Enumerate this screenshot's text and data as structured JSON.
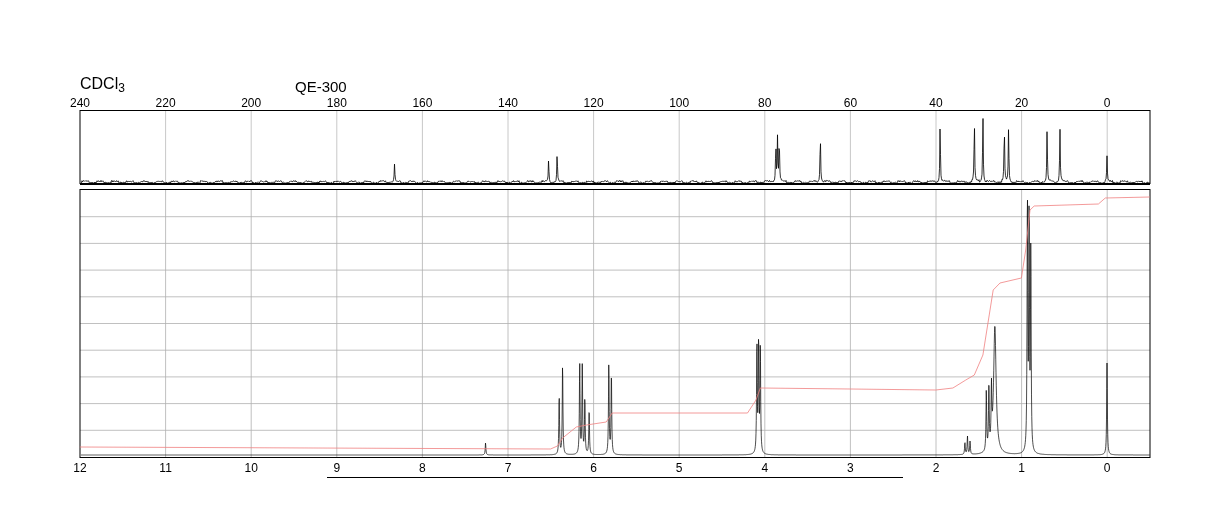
{
  "solvent": "CDCl$_{3}$",
  "instrument": "QE-300",
  "carbon_axis": {
    "ticks": [
      "240",
      "220",
      "200",
      "180",
      "160",
      "140",
      "120",
      "100",
      "80",
      "60",
      "40",
      "20",
      "0"
    ]
  },
  "proton_axis": {
    "ticks": [
      "12",
      "11",
      "10",
      "9",
      "8",
      "7",
      "6",
      "5",
      "4",
      "3",
      "2",
      "1",
      "0"
    ]
  }
}
